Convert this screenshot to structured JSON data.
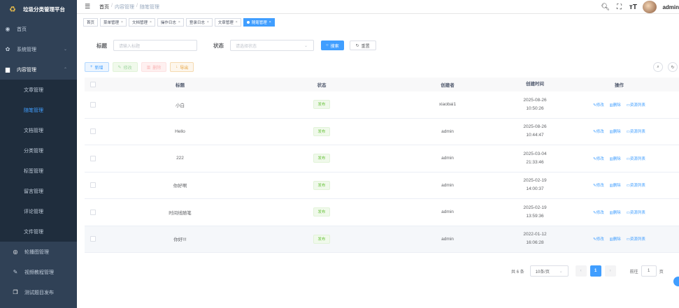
{
  "app": {
    "title": "垃圾分类管理平台"
  },
  "sidebar": {
    "home": "首页",
    "system": "系统管理",
    "content": "内容管理",
    "sub_items": [
      {
        "label": "文章管理"
      },
      {
        "label": "随笔管理"
      },
      {
        "label": "文档管理"
      },
      {
        "label": "分类管理"
      },
      {
        "label": "标签管理"
      },
      {
        "label": "留言管理"
      },
      {
        "label": "评论管理"
      },
      {
        "label": "文件管理"
      }
    ],
    "carousel": "轮播图管理",
    "video": "视频教程管理",
    "quiz": "测试题目发布"
  },
  "header": {
    "breadcrumb": [
      "首页",
      "内容管理",
      "随笔管理"
    ],
    "username": "admin"
  },
  "tags": [
    "首页",
    "菜单管理",
    "文档管理",
    "操作日志",
    "登录日志",
    "文章管理",
    "随笔管理"
  ],
  "search": {
    "title_label": "标题",
    "title_placeholder": "请输入标题",
    "status_label": "状态",
    "status_placeholder": "请选择状态",
    "search_btn": "搜索",
    "reset_btn": "重置"
  },
  "toolbar": {
    "add": "新增",
    "edit": "修改",
    "delete": "删除",
    "export": "导出"
  },
  "table": {
    "headers": {
      "title": "标题",
      "status": "状态",
      "creator": "创建者",
      "time": "创建时间",
      "ops": "操作"
    },
    "op_labels": {
      "edit": "修改",
      "delete": "删除",
      "resources": "资源列表"
    },
    "rows": [
      {
        "title": "小白",
        "status": "发布",
        "creator": "xiaobai1",
        "date": "2025-08-26",
        "time": "10:50:26"
      },
      {
        "title": "Hello",
        "status": "发布",
        "creator": "admin",
        "date": "2025-08-26",
        "time": "10:44:47"
      },
      {
        "title": "222",
        "status": "发布",
        "creator": "admin",
        "date": "2025-03-04",
        "time": "21:33:46"
      },
      {
        "title": "你好啊",
        "status": "发布",
        "creator": "admin",
        "date": "2025-02-19",
        "time": "14:00:37"
      },
      {
        "title": "时间线随笔",
        "status": "发布",
        "creator": "admin",
        "date": "2025-02-19",
        "time": "13:59:36"
      },
      {
        "title": "你好!!!",
        "status": "发布",
        "creator": "admin",
        "date": "2022-01-12",
        "time": "16:06:28"
      }
    ]
  },
  "pagination": {
    "total": "共 6 条",
    "page_size": "10条/页",
    "current": "1",
    "goto_label": "前往",
    "goto_value": "1",
    "page_unit": "页"
  }
}
